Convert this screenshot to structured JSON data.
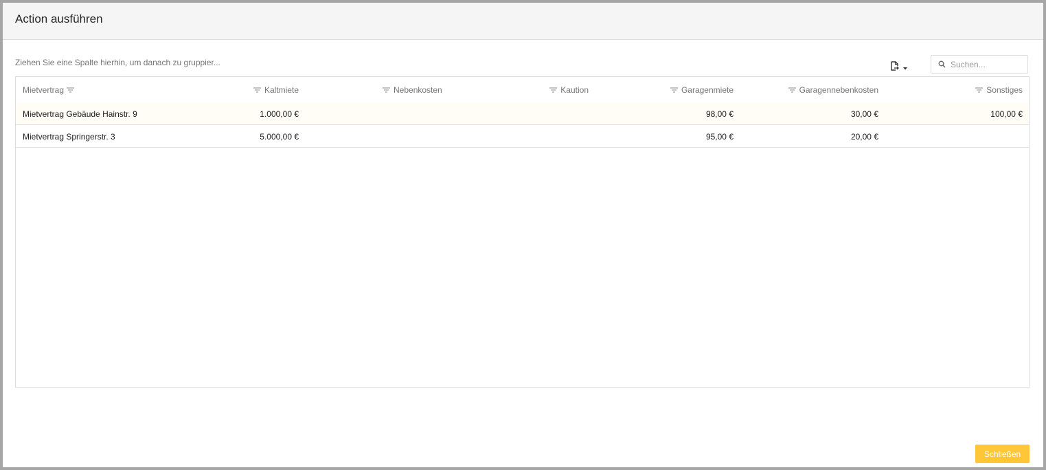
{
  "dialog": {
    "title": "Action ausführen",
    "close_label": "Schließen"
  },
  "toolbar": {
    "group_panel_text": "Ziehen Sie eine Spalte hierhin, um danach zu gruppier...",
    "export_icon": "export-file-icon",
    "search_placeholder": "Suchen...",
    "search_value": ""
  },
  "table": {
    "columns": [
      {
        "label": "Mietvertrag"
      },
      {
        "label": "Kaltmiete"
      },
      {
        "label": "Nebenkosten"
      },
      {
        "label": "Kaution"
      },
      {
        "label": "Garagenmiete"
      },
      {
        "label": "Garagennebenkosten"
      },
      {
        "label": "Sonstiges"
      }
    ],
    "rows": [
      {
        "mietvertrag": "Mietvertrag Gebäude Hainstr. 9",
        "kaltmiete": "1.000,00 €",
        "nebenkosten": "",
        "kaution": "",
        "garagenmiete": "98,00 €",
        "garagennebenkosten": "30,00 €",
        "sonstiges": "100,00 €"
      },
      {
        "mietvertrag": "Mietvertrag Springerstr. 3",
        "kaltmiete": "5.000,00 €",
        "nebenkosten": "",
        "kaution": "",
        "garagenmiete": "95,00 €",
        "garagennebenkosten": "20,00 €",
        "sonstiges": ""
      }
    ]
  },
  "colors": {
    "accent": "#ffc637",
    "header_bg": "#f5f5f5",
    "selected_row_bg": "#fffdf5"
  }
}
